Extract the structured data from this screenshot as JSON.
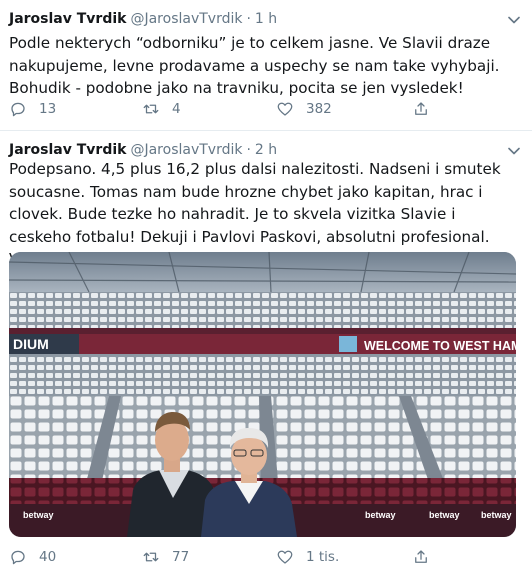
{
  "tweets": [
    {
      "author_name": "Jaroslav Tvrdik",
      "handle": "@JaroslavTvrdik",
      "separator": "·",
      "time": "1 h",
      "text": "Podle nekterych “odborniku” je to celkem jasne. Ve Slavii draze nakupujeme, levne prodavame a uspechy se nam take vyhybaji. Bohudik - podobne jako na travniku, pocita se jen vysledek!",
      "replies": "13",
      "retweets": "4",
      "likes": "382"
    },
    {
      "author_name": "Jaroslav Tvrdik",
      "handle": "@JaroslavTvrdik",
      "separator": "·",
      "time": "2 h",
      "text": "Podepsano. 4,5 plus 16,2 plus dalsi nalezitosti. Nadseni i smutek soucasne. Tomas nam bude hrozne chybet jako kapitan, hrac i clovek. Bude tezke ho nahradit. Je to skvela vizitka Slavie i ceskeho fotbalu! Dekuji i Pavlovi Paskovi, absolutni profesional. Velka osobni satisfakce!",
      "replies": "40",
      "retweets": "77",
      "likes": "1 tis.",
      "image": {
        "banner_text": "WELCOME TO WEST HAM U",
        "left_banner_text": "DIUM",
        "board_text": "betway"
      }
    }
  ],
  "colors": {
    "text": "#14171a",
    "secondary": "#657786",
    "divider": "#e6ecf0",
    "claret": "#7a2638",
    "seat_white": "#eef1f3"
  },
  "icons": {
    "reply": "reply-icon",
    "retweet": "retweet-icon",
    "like": "heart-icon",
    "share": "share-icon",
    "caret": "chevron-down-icon"
  }
}
